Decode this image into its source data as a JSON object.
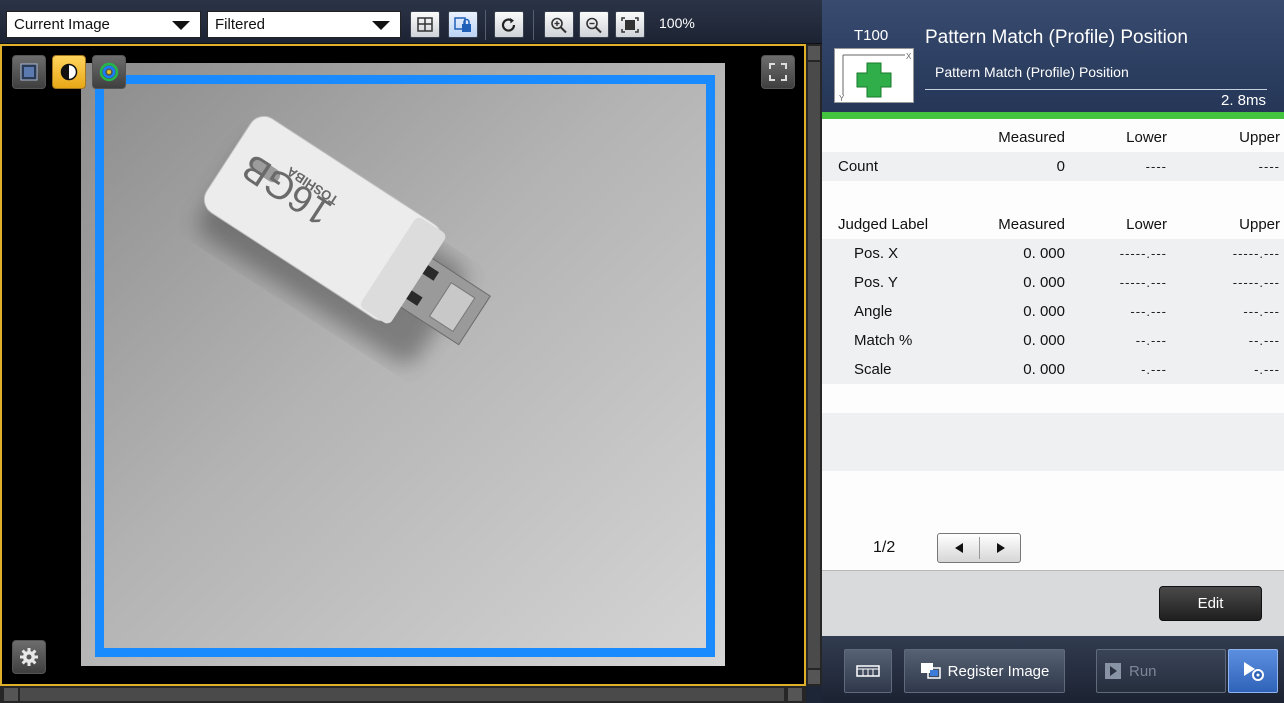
{
  "toolbar": {
    "image_select": "Current Image",
    "filter_select": "Filtered",
    "zoom_level": "100%"
  },
  "tool": {
    "id": "T100",
    "title": "Pattern Match (Profile) Position",
    "subtitle": "Pattern Match (Profile) Position",
    "time": "2. 8ms",
    "thumb_axis_x": "X",
    "thumb_axis_y": "Y"
  },
  "results": {
    "header1": {
      "c1": "",
      "c2": "Measured",
      "c3": "Lower",
      "c4": "Upper"
    },
    "count": {
      "label": "Count",
      "measured": "0",
      "lower": "----",
      "upper": "----"
    },
    "header2": {
      "c1": "Judged Label",
      "c2": "Measured",
      "c3": "Lower",
      "c4": "Upper"
    },
    "items": [
      {
        "label": "Pos.  X",
        "measured": "0. 000",
        "lower": "-----.---",
        "upper": "-----.---"
      },
      {
        "label": "Pos.  Y",
        "measured": "0. 000",
        "lower": "-----.---",
        "upper": "-----.---"
      },
      {
        "label": "Angle",
        "measured": "0. 000",
        "lower": "---.---",
        "upper": "---.---"
      },
      {
        "label": "Match  %",
        "measured": "0. 000",
        "lower": "--.---",
        "upper": "--.---"
      },
      {
        "label": "Scale",
        "measured": "0. 000",
        "lower": "-.---",
        "upper": "-.---"
      }
    ],
    "page": "1/2"
  },
  "buttons": {
    "edit": "Edit",
    "register_image": "Register Image",
    "run": "Run"
  },
  "photo": {
    "text_brand": "TOSHIBA",
    "text_capacity": "16GB"
  },
  "colors": {
    "region_border": "#1a8aff",
    "panel_border": "#e1b02a",
    "status_bar": "#44c33e",
    "header_bg": "#2c3e62"
  }
}
